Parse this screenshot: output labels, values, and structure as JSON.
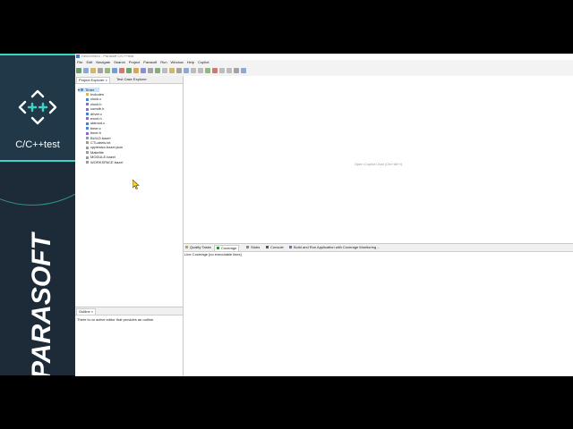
{
  "brand": {
    "product": "C/C++test",
    "company": "PARASOFT",
    "accent_color": "#3fd3c6",
    "logo_icon": "cpp-arrows-icon"
  },
  "ide": {
    "title": "DemoVideo - Parasoft C/C++test",
    "menu": [
      "File",
      "Edit",
      "Navigate",
      "Search",
      "Project",
      "Parasoft",
      "Run",
      "Window",
      "Help",
      "Copilot"
    ],
    "left_tabs": [
      "Project Explorer",
      "Test Case Explorer"
    ],
    "project": {
      "root": "Timer",
      "items": [
        {
          "label": "Includes",
          "type": "folder"
        },
        {
          "label": "clock.c",
          "type": "c"
        },
        {
          "label": "clock.h",
          "type": "h"
        },
        {
          "label": "comdb.h",
          "type": "h"
        },
        {
          "label": "driver.c",
          "type": "c"
        },
        {
          "label": "excel.h",
          "type": "h"
        },
        {
          "label": "stdmod.c",
          "type": "c"
        },
        {
          "label": "timer.c",
          "type": "c"
        },
        {
          "label": "timer.h",
          "type": "h"
        },
        {
          "label": "BUILD.bazel",
          "type": "file"
        },
        {
          "label": "CTLabels.txt",
          "type": "file"
        },
        {
          "label": "cpptestcc.bazel.json",
          "type": "file"
        },
        {
          "label": "Makefile",
          "type": "file"
        },
        {
          "label": "MODULE.bazel",
          "type": "file"
        },
        {
          "label": "WORKSPACE.bazel",
          "type": "file"
        }
      ]
    },
    "editor_hint": "Open Copilot Chat (Ctrl+Alt+I)",
    "bottom_tabs": [
      "Quality Tasks",
      "Coverage",
      "Stubs",
      "Console",
      "Build and Run Application with Coverage Monitoring ..."
    ],
    "coverage_text": "Line Coverage [no executable lines]",
    "outline": {
      "tab": "Outline",
      "message": "There is no active editor that provides an outline."
    }
  }
}
